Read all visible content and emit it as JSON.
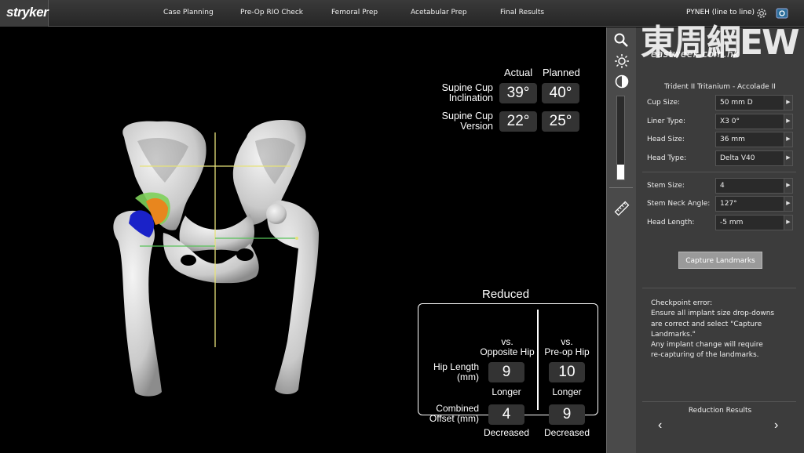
{
  "topbar": {
    "logo": "stryker",
    "tabs": [
      "Case Planning",
      "Pre-Op RIO Check",
      "Femoral Prep",
      "Acetabular Prep",
      "Final Results"
    ],
    "user": "PYNEH (line to line)"
  },
  "cup_metrics": {
    "col_actual": "Actual",
    "col_planned": "Planned",
    "rows": [
      {
        "label_line1": "Supine Cup",
        "label_line2": "Inclination",
        "actual": "39°",
        "planned": "40°"
      },
      {
        "label_line1": "Supine Cup",
        "label_line2": "Version",
        "actual": "22°",
        "planned": "25°"
      }
    ]
  },
  "reduced": {
    "title": "Reduced",
    "col1_line1": "vs.",
    "col1_line2": "Opposite Hip",
    "col2_line1": "vs.",
    "col2_line2": "Pre-op Hip",
    "rows": [
      {
        "label_line1": "Hip Length",
        "label_line2": "(mm)",
        "v1": "9",
        "s1": "Longer",
        "v2": "10",
        "s2": "Longer"
      },
      {
        "label_line1": "Combined",
        "label_line2": "Offset (mm)",
        "v1": "4",
        "s1": "Decreased",
        "v2": "9",
        "s2": "Decreased"
      }
    ]
  },
  "tools": {
    "icons": [
      "magnifier-icon",
      "brightness-icon",
      "contrast-icon",
      "ruler-icon"
    ],
    "brightness_level": 0.18
  },
  "panel": {
    "title": "Trident II Tritanium - Accolade II",
    "fields_group1": [
      {
        "label": "Cup Size:",
        "value": "50 mm D"
      },
      {
        "label": "Liner Type:",
        "value": "X3 0°"
      },
      {
        "label": "Head Size:",
        "value": "36 mm"
      },
      {
        "label": "Head Type:",
        "value": "Delta V40"
      }
    ],
    "fields_group2": [
      {
        "label": "Stem Size:",
        "value": "4"
      },
      {
        "label": "Stem Neck Angle:",
        "value": "127°"
      },
      {
        "label": "Head Length:",
        "value": "-5 mm"
      }
    ],
    "capture_button": "Capture Landmarks",
    "checkpoint_lines": [
      "Checkpoint error:",
      "Ensure all implant size drop-downs",
      "are correct and select \"Capture",
      "Landmarks.\"",
      "Any implant change will require",
      "re-capturing of the landmarks."
    ],
    "reduction_results": "Reduction Results"
  },
  "watermark": {
    "main": "東周網EW",
    "sub": "eastweek.com.hk"
  },
  "colors": {
    "implant_blue": "#1a22c8",
    "implant_orange": "#e8861e",
    "implant_green": "#7ed05a",
    "yellow_line": "#e6e27a",
    "green_line": "#58c25a"
  }
}
